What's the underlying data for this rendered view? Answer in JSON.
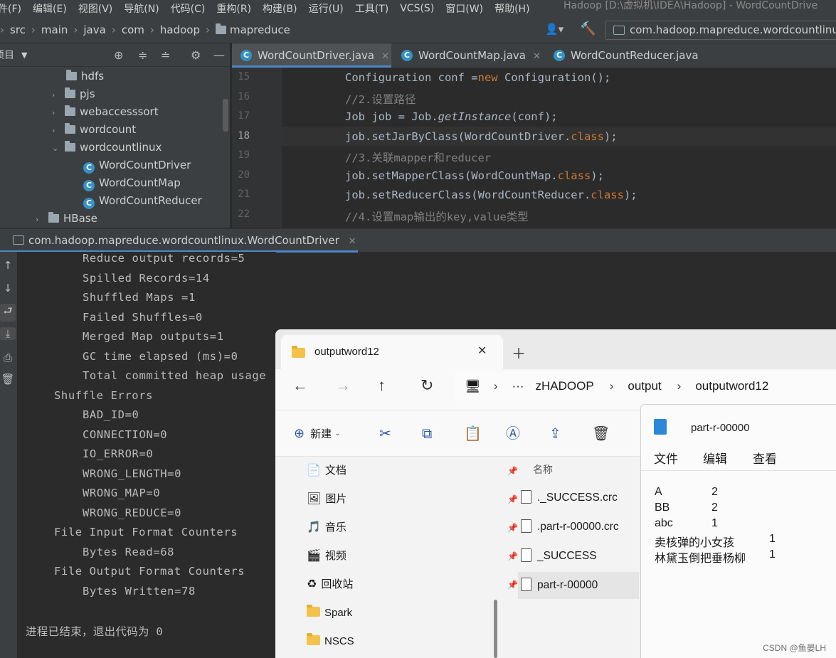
{
  "menubar": {
    "items": [
      "件(F)",
      "编辑(E)",
      "视图(V)",
      "导航(N)",
      "代码(C)",
      "重构(R)",
      "构建(B)",
      "运行(U)",
      "工具(T)",
      "VCS(S)",
      "窗口(W)",
      "帮助(H)"
    ],
    "window_title": "Hadoop [D:\\虚拟机\\IDEA\\Hadoop] - WordCountDrive"
  },
  "breadcrumb": [
    "src",
    "main",
    "java",
    "com",
    "hadoop",
    "mapreduce"
  ],
  "run_config": "com.hadoop.mapreduce.wordcountlinux",
  "project": {
    "header": "项目",
    "tree": [
      {
        "label": "hdfs",
        "type": "folder",
        "arrow": ""
      },
      {
        "label": "pjs",
        "type": "folder",
        "arrow": "›"
      },
      {
        "label": "webaccesssort",
        "type": "folder",
        "arrow": "›"
      },
      {
        "label": "wordcount",
        "type": "folder",
        "arrow": "›"
      },
      {
        "label": "wordcountlinux",
        "type": "folder",
        "arrow": "⌄"
      },
      {
        "label": "WordCountDriver",
        "type": "class",
        "arrow": ""
      },
      {
        "label": "WordCountMap",
        "type": "class",
        "arrow": ""
      },
      {
        "label": "WordCountReducer",
        "type": "class",
        "arrow": ""
      },
      {
        "label": "HBase",
        "type": "folder",
        "arrow": "›"
      }
    ]
  },
  "editor": {
    "tabs": [
      "WordCountDriver.java",
      "WordCountMap.java",
      "WordCountReducer.java"
    ],
    "line_numbers": [
      "15",
      "16",
      "17",
      "18",
      "19",
      "20",
      "21",
      "22"
    ],
    "current_line": "18",
    "code": {
      "l15a": "Configuration conf =",
      "l15b": "new",
      "l15c": " Configuration();",
      "l16": "//2.设置路径",
      "l17a": "Job job = Job.",
      "l17b": "getInstance",
      "l17c": "(conf);",
      "l18a": "job.setJarByClass(WordCountDriver.",
      "l18b": "class",
      "l18c": ");",
      "l19": "//3.关联mapper和reducer",
      "l20a": "job.setMapperClass(WordCountMap.",
      "l20b": "class",
      "l20c": ");",
      "l21a": "job.setReducerClass(WordCountReducer.",
      "l21b": "class",
      "l21c": ");",
      "l22": "//4.设置map输出的key,value类型"
    }
  },
  "run": {
    "tab_title": "com.hadoop.mapreduce.wordcountlinux.WordCountDriver",
    "console_lines": [
      "Reduce output records=5",
      "Spilled Records=14",
      "Shuffled Maps =1",
      "Failed Shuffles=0",
      "Merged Map outputs=1",
      "GC time elapsed (ms)=0",
      "Total committed heap usage",
      "Shuffle Errors",
      "BAD_ID=0",
      "CONNECTION=0",
      "IO_ERROR=0",
      "WRONG_LENGTH=0",
      "WRONG_MAP=0",
      "WRONG_REDUCE=0",
      "File Input Format Counters",
      "Bytes Read=68",
      "File Output Format Counters",
      "Bytes Written=78"
    ],
    "exit_message": "进程已结束，退出代码为 0"
  },
  "explorer": {
    "tab_title": "outputword12",
    "path": [
      "···",
      "zHADOOP",
      "output",
      "outputword12"
    ],
    "new_button": "新建",
    "column_name": "名称",
    "sidebar": [
      {
        "label": "文档",
        "pinned": true
      },
      {
        "label": "图片",
        "pinned": true
      },
      {
        "label": "音乐",
        "pinned": true
      },
      {
        "label": "视频",
        "pinned": true
      },
      {
        "label": "回收站",
        "pinned": true
      },
      {
        "label": "Spark",
        "pinned": false
      },
      {
        "label": "NSCS",
        "pinned": false
      }
    ],
    "files": [
      "._SUCCESS.crc",
      ".part-r-00000.crc",
      "_SUCCESS",
      "part-r-00000"
    ],
    "selected_file": "part-r-00000"
  },
  "notepad": {
    "title": "part-r-00000",
    "menu": [
      "文件",
      "编辑",
      "查看"
    ],
    "lines": [
      {
        "word": "A",
        "count": "2"
      },
      {
        "word": "BB",
        "count": "2"
      },
      {
        "word": "abc",
        "count": "1"
      },
      {
        "word": "卖核弹的小女孩",
        "count": "1"
      },
      {
        "word": "林黛玉倒把垂杨柳",
        "count": "1"
      }
    ]
  },
  "watermark": "CSDN @鱼晏LH"
}
